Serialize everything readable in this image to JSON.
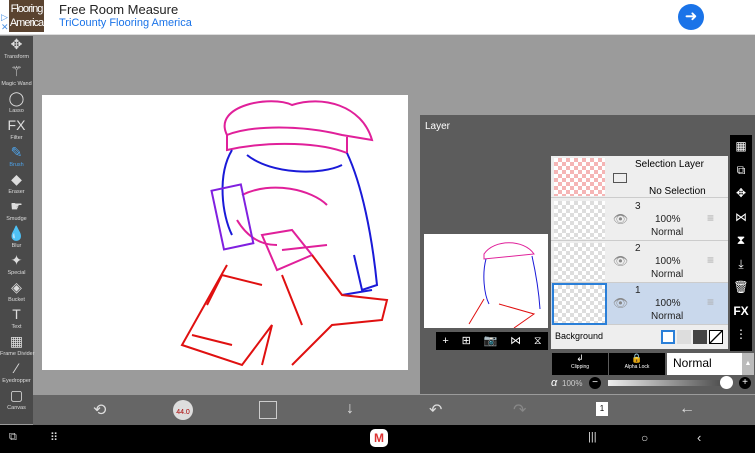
{
  "ad": {
    "logo_text": "Flooring America",
    "title": "Free Room Measure",
    "subtitle": "TriCounty Flooring America"
  },
  "tools": [
    {
      "label": "Transform",
      "icon": "✥"
    },
    {
      "label": "Magic Wand",
      "icon": "⚚"
    },
    {
      "label": "Lasso",
      "icon": "◯"
    },
    {
      "label": "Filter",
      "icon": "FX"
    },
    {
      "label": "Brush",
      "icon": "✎"
    },
    {
      "label": "Eraser",
      "icon": "◆"
    },
    {
      "label": "Smudge",
      "icon": "☛"
    },
    {
      "label": "Blur",
      "icon": "💧"
    },
    {
      "label": "Special",
      "icon": "✦"
    },
    {
      "label": "Bucket",
      "icon": "◈"
    },
    {
      "label": "Text",
      "icon": "T"
    },
    {
      "label": "Frame Divider",
      "icon": "▦"
    },
    {
      "label": "Eyedropper",
      "icon": "⁄"
    },
    {
      "label": "Canvas",
      "icon": "▢"
    }
  ],
  "active_tool": "Brush",
  "layer_panel": {
    "title": "Layer",
    "selection_layer": {
      "name": "Selection Layer",
      "status": "No Selection"
    },
    "layers": [
      {
        "num": "3",
        "opacity": "100%",
        "blend": "Normal"
      },
      {
        "num": "2",
        "opacity": "100%",
        "blend": "Normal"
      },
      {
        "num": "1",
        "opacity": "100%",
        "blend": "Normal",
        "selected": true
      }
    ],
    "background_label": "Background",
    "clipping_label": "Clipping",
    "alpha_lock_label": "Alpha Lock",
    "blend_mode": "Normal",
    "alpha_label": "α",
    "alpha_value": "100%",
    "alpha_fraction": 1.0
  },
  "bottom": {
    "brush_size": "44.0",
    "page_num": "1"
  },
  "colors": {
    "accent": "#2a7fd8",
    "toolbar": "#4a4a4a"
  }
}
